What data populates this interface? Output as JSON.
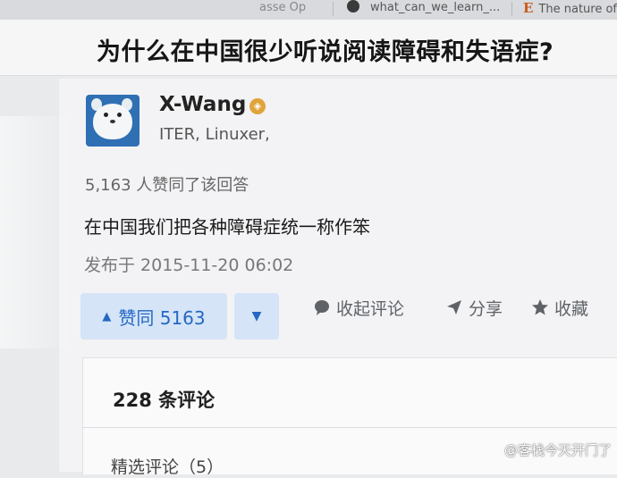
{
  "browser": {
    "tabs": [
      {
        "label": "asse Op"
      },
      {
        "label": "what_can_we_learn_..."
      },
      {
        "label": "The nature of"
      }
    ]
  },
  "question": {
    "title": "为什么在中国很少听说阅读障碍和失语症?"
  },
  "answer": {
    "author_name": "X-Wang",
    "author_bio": "ITER, Linuxer,",
    "vote_summary": "5,163 人赞同了该回答",
    "content": "在中国我们把各种障碍症统一称作笨",
    "publish_time": "发布于 2015-11-20 06:02"
  },
  "actions": {
    "upvote_label": "赞同 5163",
    "collapse_comments_label": "收起评论",
    "share_label": "分享",
    "collect_label": "收藏"
  },
  "comments": {
    "count_label": "228 条评论",
    "featured_label": "精选评论（5）"
  },
  "watermark": "@客栈今天开门了",
  "colors": {
    "accent": "#2468c4",
    "vote_bg": "#d5e4f7",
    "badge": "#e0a43a",
    "avatar_bg": "#2f6fb3"
  }
}
